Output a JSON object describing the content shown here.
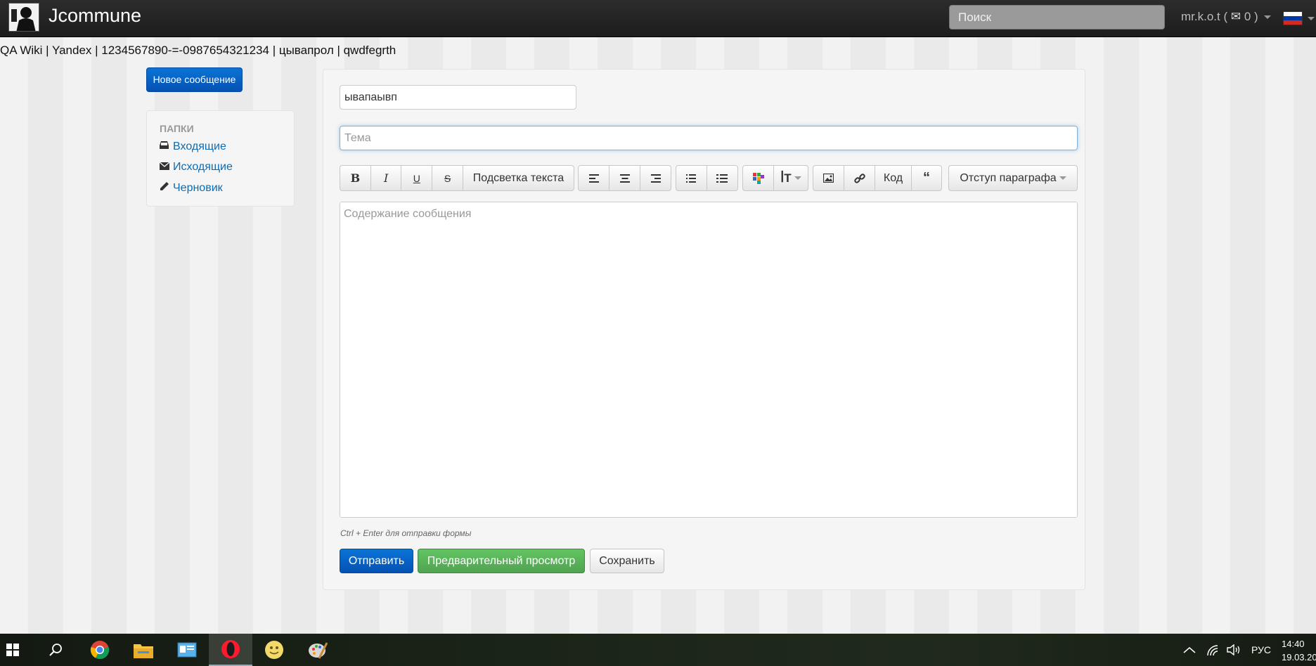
{
  "navbar": {
    "brand": "Jcommune",
    "search_placeholder": "Поиск",
    "user_prefix": "mr.k.o.t (",
    "message_count": "0",
    "user_suffix": ")"
  },
  "bookmarks": {
    "text": "QA Wiki | Yandex | 1234567890-=-0987654321234 | цывапрол | qwdfegrth"
  },
  "sidebar": {
    "new_message_label": "Новое сообщение",
    "folders_title": "ПАПКИ",
    "folders": [
      {
        "label": "Входящие",
        "icon": "inbox-icon"
      },
      {
        "label": "Исходящие",
        "icon": "envelope-icon"
      },
      {
        "label": "Черновик",
        "icon": "pencil-icon"
      }
    ]
  },
  "compose": {
    "recipient_value": "ывапаывп",
    "subject_placeholder": "Тема",
    "body_placeholder": "Содержание сообщения",
    "toolbar": {
      "bold": "B",
      "italic": "I",
      "underline": "U",
      "strike": "S",
      "highlight": "Подсветка текста",
      "code": "Код",
      "quote": "“",
      "indent": "Отступ параграфа"
    },
    "hint": "Ctrl + Enter для отправки формы",
    "send_label": "Отправить",
    "preview_label": "Предварительный просмотр",
    "save_label": "Сохранить"
  },
  "taskbar": {
    "language": "РУС",
    "time": "14:40",
    "date": "19.03.20"
  },
  "colors": {
    "primary": "#0551b3",
    "success": "#51a351",
    "link": "#0b6cb5",
    "navbar": "#222222"
  }
}
